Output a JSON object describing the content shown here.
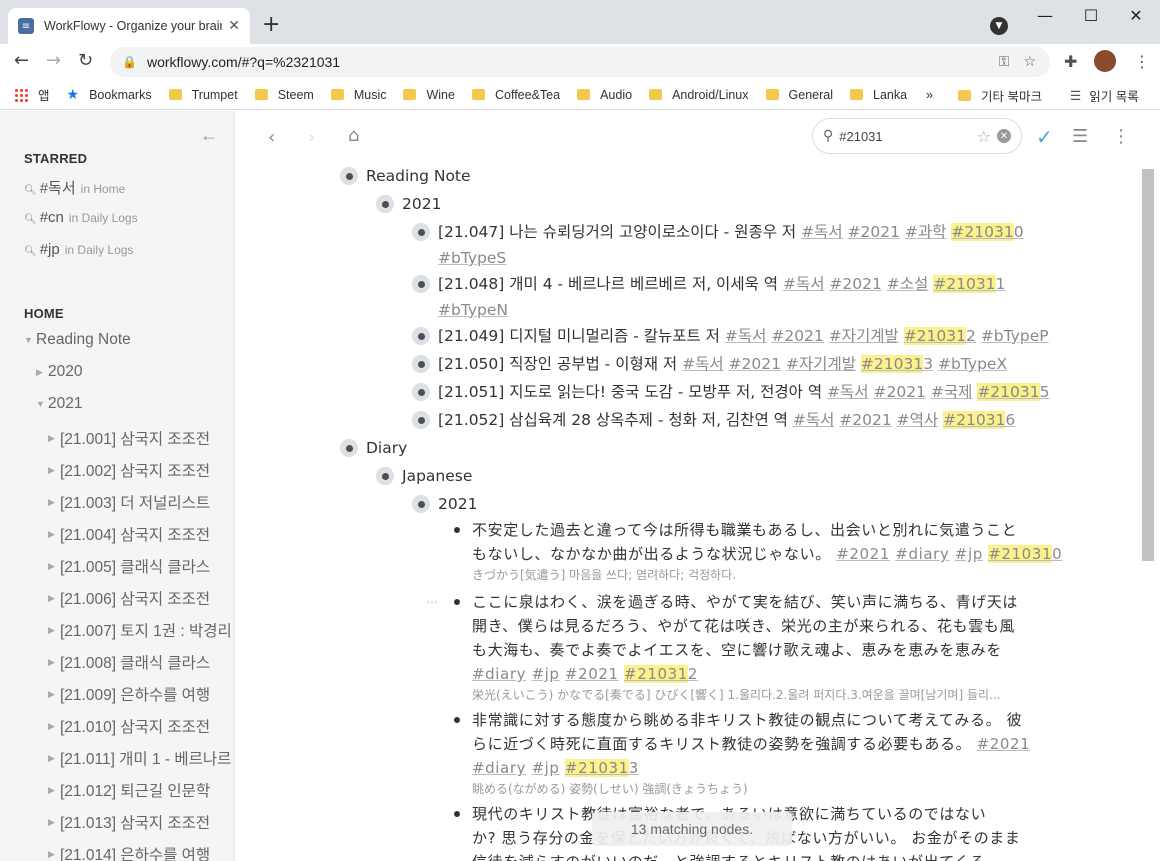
{
  "browser": {
    "tab_title": "WorkFlowy - Organize your brain",
    "url": "workflowy.com/#?q=%2321031",
    "bookmarks": [
      {
        "label": "앱",
        "type": "apps"
      },
      {
        "label": "Bookmarks",
        "type": "star"
      },
      {
        "label": "Trumpet",
        "type": "folder"
      },
      {
        "label": "Steem",
        "type": "folder"
      },
      {
        "label": "Music",
        "type": "folder"
      },
      {
        "label": "Wine",
        "type": "folder"
      },
      {
        "label": "Coffee&Tea",
        "type": "folder"
      },
      {
        "label": "Audio",
        "type": "folder"
      },
      {
        "label": "Android/Linux",
        "type": "folder"
      },
      {
        "label": "General",
        "type": "folder"
      },
      {
        "label": "Lanka",
        "type": "folder"
      }
    ],
    "bookmarks_more": "»",
    "other_bookmarks": "기타 북마크",
    "reading_list": "읽기 목록"
  },
  "sidebar": {
    "starred_heading": "STARRED",
    "starred": [
      {
        "query": "#독서",
        "location": "in Home"
      },
      {
        "query": "#cn",
        "location": "in Daily Logs"
      },
      {
        "query": "#jp",
        "location": "in Daily Logs"
      }
    ],
    "home_heading": "HOME",
    "tree": [
      {
        "label": "Reading Note",
        "level": 0,
        "arrow": "▼"
      },
      {
        "label": "2020",
        "level": 1,
        "arrow": "▶"
      },
      {
        "label": "2021",
        "level": 1,
        "arrow": "▼"
      },
      {
        "label": "[21.001] 삼국지 조조전",
        "level": 2,
        "arrow": "▶"
      },
      {
        "label": "[21.002] 삼국지 조조전",
        "level": 2,
        "arrow": "▶"
      },
      {
        "label": "[21.003] 더 저널리스트",
        "level": 2,
        "arrow": "▶"
      },
      {
        "label": "[21.004] 삼국지 조조전",
        "level": 2,
        "arrow": "▶"
      },
      {
        "label": "[21.005] 클래식 클라스",
        "level": 2,
        "arrow": "▶"
      },
      {
        "label": "[21.006] 삼국지 조조전",
        "level": 2,
        "arrow": "▶"
      },
      {
        "label": "[21.007] 토지 1권 : 박경리",
        "level": 2,
        "arrow": "▶"
      },
      {
        "label": "[21.008] 클래식 클라스",
        "level": 2,
        "arrow": "▶"
      },
      {
        "label": "[21.009] 은하수를 여행",
        "level": 2,
        "arrow": "▶"
      },
      {
        "label": "[21.010] 삼국지 조조전",
        "level": 2,
        "arrow": "▶"
      },
      {
        "label": "[21.011] 개미 1 - 베르나르",
        "level": 2,
        "arrow": "▶"
      },
      {
        "label": "[21.012] 퇴근길 인문학",
        "level": 2,
        "arrow": "▶"
      },
      {
        "label": "[21.013] 삼국지 조조전",
        "level": 2,
        "arrow": "▶"
      },
      {
        "label": "[21.014] 은하수를 여행",
        "level": 2,
        "arrow": "▶"
      }
    ]
  },
  "search": {
    "query": "#21031",
    "match_count_text": "13 matching nodes."
  },
  "outline": {
    "reading_note": "Reading Note",
    "year": "2021",
    "books": [
      {
        "title": "[21.047] 나는 슈뢰딩거의 고양이로소이다 - 원종우 저",
        "tags": [
          "#독서",
          "#2021",
          "#과학"
        ],
        "hl": "#21031",
        "hl_rest": "0",
        "tag2": "#bTypeS"
      },
      {
        "title": "[21.048] 개미 4 - 베르나르 베르베르 저, 이세욱 역",
        "tags": [
          "#독서",
          "#2021",
          "#소설"
        ],
        "hl": "#21031",
        "hl_rest": "1",
        "tag2": "#bTypeN"
      },
      {
        "title": "[21.049] 디지털 미니멀리즘 - 칼뉴포트 저",
        "tags": [
          "#독서",
          "#2021",
          "#자기계발"
        ],
        "hl": "#21031",
        "hl_rest": "2",
        "tag2": "#bTypeP"
      },
      {
        "title": "[21.050] 직장인 공부법 - 이형재 저",
        "tags": [
          "#독서",
          "#2021",
          "#자기계발"
        ],
        "hl": "#21031",
        "hl_rest": "3",
        "tag2": "#bTypeX"
      },
      {
        "title": "[21.051] 지도로 읽는다! 중국 도감 - 모방푸 저, 전경아 역",
        "tags": [
          "#독서",
          "#2021",
          "#국제"
        ],
        "hl": "#21031",
        "hl_rest": "5",
        "tag2": ""
      },
      {
        "title": "[21.052] 삼십육계 28 상옥추제 - 청화 저, 김찬연 역",
        "tags": [
          "#독서",
          "#2021",
          "#역사"
        ],
        "hl": "#21031",
        "hl_rest": "6",
        "tag2": ""
      }
    ],
    "diary": "Diary",
    "japanese": "Japanese",
    "diary_year": "2021",
    "entries": [
      {
        "line1": "不安定した過去と違って今は所得も職業もあるし、出会いと別れに気遣うこと",
        "line2": "もないし、なかなか曲が出るような状況じゃない。",
        "tags": [
          "#2021",
          "#diary",
          "#jp"
        ],
        "hl": "#21031",
        "hl_rest": "0",
        "note": "きづかう[気遣う] 마음을 쓰다; 염려하다; 걱정하다."
      },
      {
        "line1": "ここに泉はわく、涙を過ぎる時、やがて実を結び、笑い声に満ちる、青げ天は",
        "line2": "開き、僕らは見るだろう、やがて花は咲き、栄光の主が来られる、花も雲も風",
        "line3": "も大海も、奏でよ奏でよイエスを、空に響け歌え魂よ、恵みを恵みを恵みを",
        "tags": [
          "#diary",
          "#jp",
          "#2021"
        ],
        "hl": "#21031",
        "hl_rest": "2",
        "note": "栄光(えいこう) かなでる[奏でる] ひびく[響く] 1.울리다.2.울려 퍼지다.3.여운을 끌며[남기며] 들리..."
      },
      {
        "line1": "非常識に対する態度から眺める非キリスト教徒の観点について考えてみる。 彼",
        "line2": "らに近づく時死に直面するキリスト教徒の姿勢を強調する必要もある。",
        "tags": [
          "#2021",
          "#diary",
          "#jp"
        ],
        "hl": "#21031",
        "hl_rest": "3",
        "note": "眺める(ながめる) 姿勢(しせい) 強調(きょうちょう)"
      },
      {
        "line1": "現代のキリスト教徒は富裕な者で、あるいは意欲に満ちているのではない",
        "line2": "か? 思う存分の金を保とたい方が良くて、説ばない方がいい。 お金がそのまま",
        "line3": "信徒を減らすのがいいのだ、と強調するとキリスト教のはあいが出てくる。",
        "tags": [],
        "hl": "",
        "hl_rest": "",
        "note": ""
      }
    ]
  }
}
